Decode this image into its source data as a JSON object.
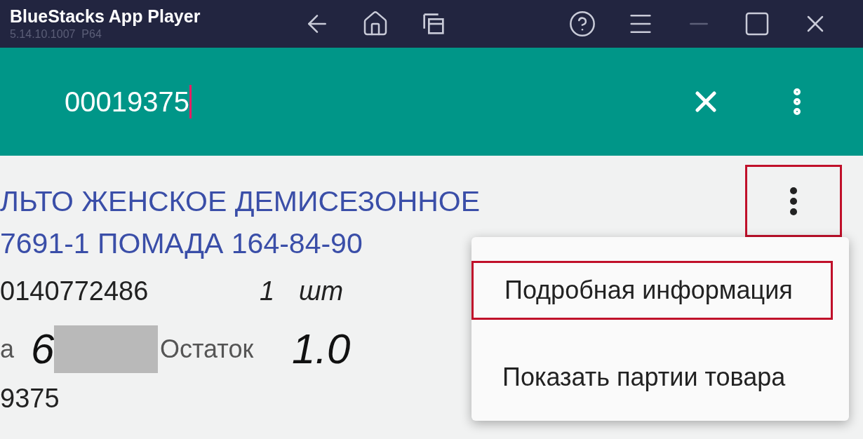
{
  "window": {
    "title": "BlueStacks App Player",
    "version": "5.14.10.1007  P64"
  },
  "search": {
    "value": "00019375"
  },
  "product": {
    "title_lines": [
      "ЛЬТО ЖЕНСКОЕ ДЕМИСЕЗОННОЕ",
      "7691-1 ПОМАДА 164-84-90"
    ],
    "barcode": "0140772486",
    "quantity": "1",
    "unit": "шт",
    "price_label": "а",
    "price": "6",
    "price_redacted": true,
    "stock_label": "Остаток",
    "stock": "1.0",
    "code": "9375",
    "menu_button_highlighted": true
  },
  "menu": {
    "items": [
      {
        "label": "Подробная информация",
        "highlighted": true
      },
      {
        "label": "Показать партии товара",
        "highlighted": false
      }
    ]
  }
}
